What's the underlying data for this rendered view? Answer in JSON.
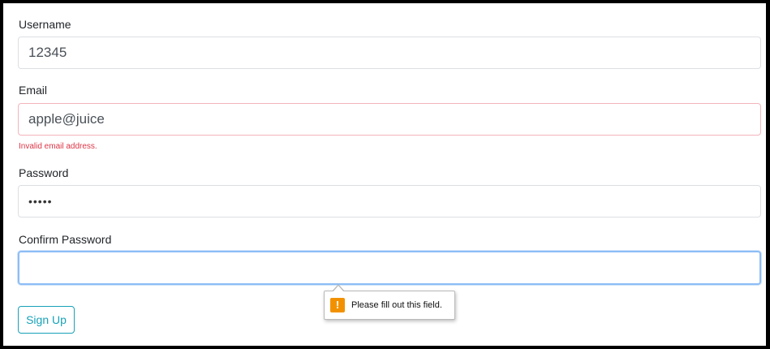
{
  "form": {
    "username": {
      "label": "Username",
      "value": "12345"
    },
    "email": {
      "label": "Email",
      "value": "apple@juice",
      "error": "Invalid email address."
    },
    "password": {
      "label": "Password",
      "masked_value": "•••••"
    },
    "confirm_password": {
      "label": "Confirm Password",
      "value": ""
    },
    "submit_label": "Sign Up"
  },
  "validation_tooltip": {
    "icon": "warning-icon",
    "icon_glyph": "!",
    "message": "Please fill out this field."
  },
  "colors": {
    "error": "#dc3545",
    "button_accent": "#17a2b8",
    "focus_ring": "#8dbdf5",
    "warning_icon": "#f29100"
  }
}
